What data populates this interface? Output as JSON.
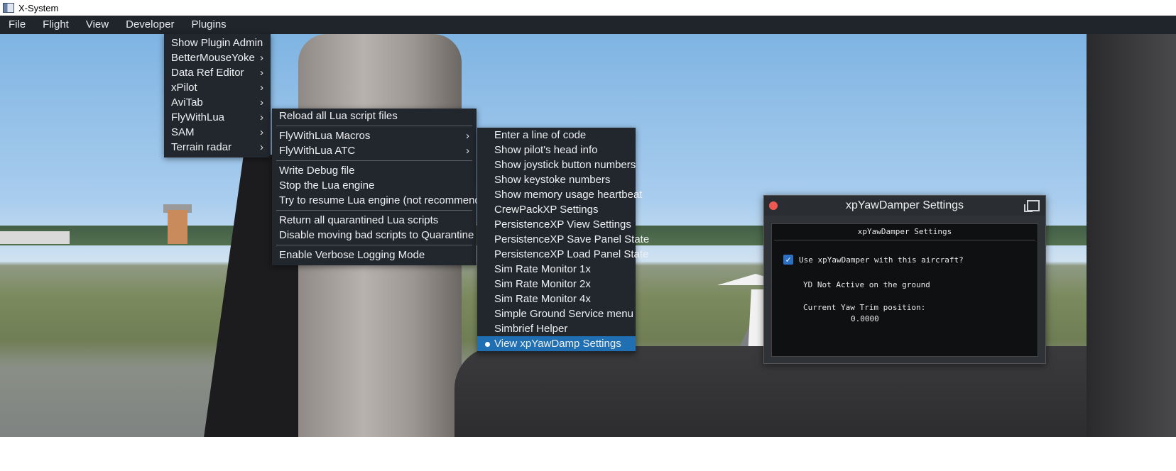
{
  "window": {
    "title": "X-System"
  },
  "menubar": [
    "File",
    "Flight",
    "View",
    "Developer",
    "Plugins"
  ],
  "plugins_menu": [
    {
      "label": "Show Plugin Admin",
      "submenu": false
    },
    {
      "label": "BetterMouseYoke",
      "submenu": true
    },
    {
      "label": "Data Ref Editor",
      "submenu": true
    },
    {
      "label": "xPilot",
      "submenu": true
    },
    {
      "label": "AviTab",
      "submenu": true
    },
    {
      "label": "FlyWithLua",
      "submenu": true
    },
    {
      "label": "SAM",
      "submenu": true
    },
    {
      "label": "Terrain radar",
      "submenu": true
    }
  ],
  "flywithlua_menu": [
    {
      "label": "Reload all Lua script files"
    },
    {
      "sep": true
    },
    {
      "label": "FlyWithLua Macros",
      "submenu": true
    },
    {
      "label": "FlyWithLua ATC",
      "submenu": true
    },
    {
      "sep": true
    },
    {
      "label": "Write Debug file"
    },
    {
      "label": "Stop the Lua engine"
    },
    {
      "label": "Try to resume Lua engine (not recommended)"
    },
    {
      "sep": true
    },
    {
      "label": "Return all quarantined Lua scripts"
    },
    {
      "label": "Disable moving bad scripts to Quarantine"
    },
    {
      "sep": true
    },
    {
      "label": "Enable Verbose Logging Mode"
    }
  ],
  "macros_menu": [
    {
      "label": "Enter a line of code"
    },
    {
      "label": "Show pilot's head info"
    },
    {
      "label": "Show joystick button numbers"
    },
    {
      "label": "Show keystoke numbers"
    },
    {
      "label": "Show memory usage heartbeat"
    },
    {
      "label": "CrewPackXP Settings"
    },
    {
      "label": "PersistenceXP View Settings"
    },
    {
      "label": "PersistenceXP Save Panel State"
    },
    {
      "label": "PersistenceXP Load Panel State"
    },
    {
      "label": "Sim Rate Monitor 1x"
    },
    {
      "label": "Sim Rate Monitor 2x"
    },
    {
      "label": "Sim Rate Monitor 4x"
    },
    {
      "label": "Simple Ground Service menu"
    },
    {
      "label": "Simbrief Helper"
    },
    {
      "label": "View xpYawDamp Settings",
      "selected": true
    }
  ],
  "yaw_window": {
    "title": "xpYawDamper Settings",
    "header": "xpYawDamper Settings",
    "checkbox_label": "Use xpYawDamper with this aircraft?",
    "checked": true,
    "status": "YD Not Active on the ground",
    "trim_label": "Current Yaw Trim position:",
    "trim_value": "0.0000"
  },
  "colors": {
    "menu_bg": "#22262d",
    "highlight": "#1f6fb2",
    "close_button": "#ee5a52"
  }
}
